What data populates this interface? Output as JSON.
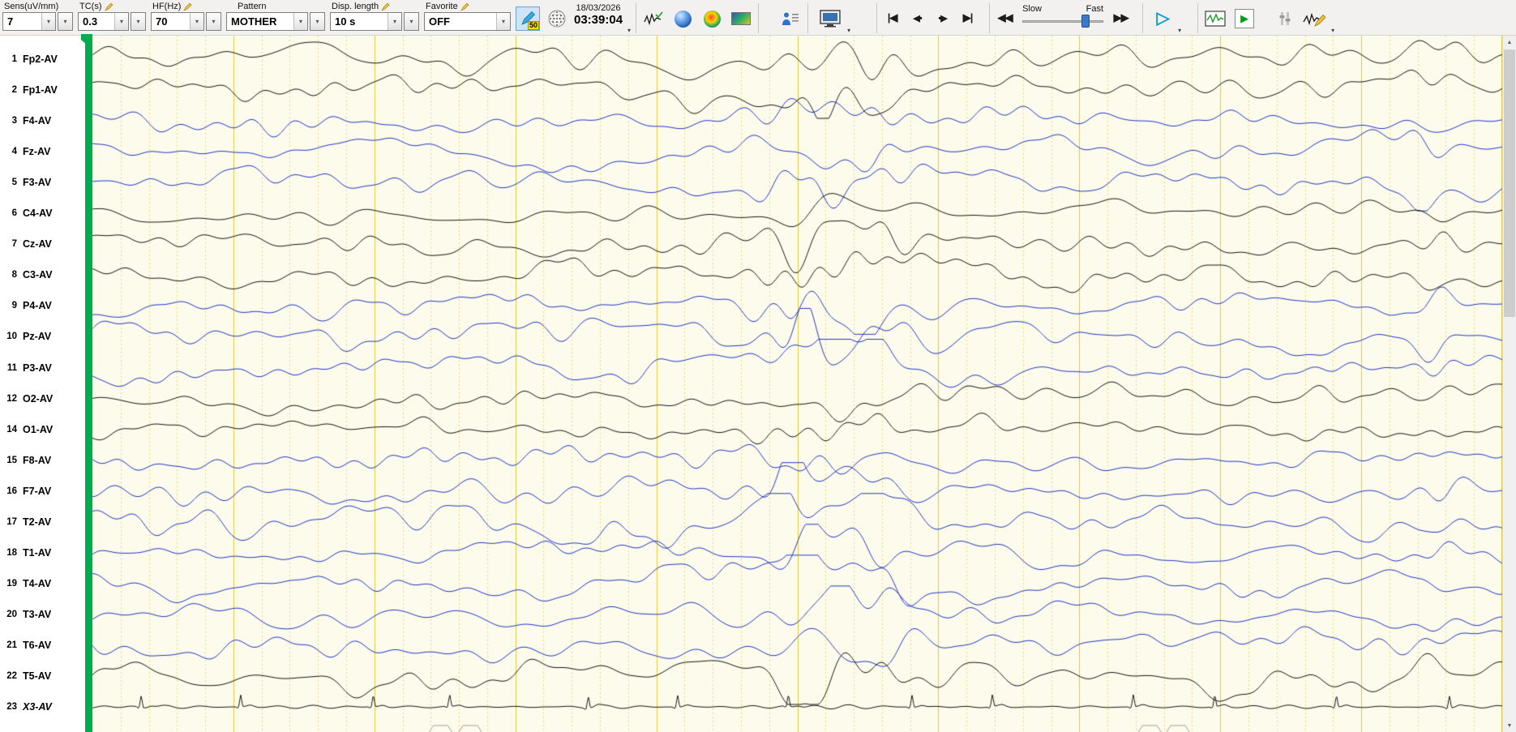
{
  "toolbar": {
    "sens": {
      "label": "Sens(uV/mm)",
      "value": "7"
    },
    "tc": {
      "label": "TC(s)",
      "value": "0.3"
    },
    "hf": {
      "label": "HF(Hz)",
      "value": "70"
    },
    "pattern": {
      "label": "Pattern",
      "value": "MOTHER"
    },
    "disp_length": {
      "label": "Disp. length",
      "value": "10 s"
    },
    "favorite": {
      "label": "Favorite",
      "value": "OFF"
    },
    "notch_badge": "50",
    "date": "18/03/2026",
    "time": "03:39:04",
    "speed": {
      "slow_label": "Slow",
      "fast_label": "Fast"
    }
  },
  "icons": {
    "combo_arrow": "▾",
    "dropdown_arrow": "▾",
    "skip_start": "|◀",
    "step_back": "◀•",
    "step_forward": "•▶",
    "skip_end": "▶|",
    "rewind": "◀◀",
    "forward": "▶▶",
    "play": "▷",
    "green_play": "▶",
    "scroll_up": "▲",
    "scroll_down": "▼"
  },
  "channels": [
    {
      "num": "1",
      "label": "Fp2-AV",
      "color": "black"
    },
    {
      "num": "2",
      "label": "Fp1-AV",
      "color": "black"
    },
    {
      "num": "3",
      "label": "F4-AV",
      "color": "blue"
    },
    {
      "num": "4",
      "label": "Fz-AV",
      "color": "blue"
    },
    {
      "num": "5",
      "label": "F3-AV",
      "color": "blue"
    },
    {
      "num": "6",
      "label": "C4-AV",
      "color": "black"
    },
    {
      "num": "7",
      "label": "Cz-AV",
      "color": "black"
    },
    {
      "num": "8",
      "label": "C3-AV",
      "color": "black"
    },
    {
      "num": "9",
      "label": "P4-AV",
      "color": "blue"
    },
    {
      "num": "10",
      "label": "Pz-AV",
      "color": "blue"
    },
    {
      "num": "11",
      "label": "P3-AV",
      "color": "blue"
    },
    {
      "num": "12",
      "label": "O2-AV",
      "color": "black"
    },
    {
      "num": "14",
      "label": "O1-AV",
      "color": "black"
    },
    {
      "num": "15",
      "label": "F8-AV",
      "color": "blue"
    },
    {
      "num": "16",
      "label": "F7-AV",
      "color": "blue"
    },
    {
      "num": "17",
      "label": "T2-AV",
      "color": "blue"
    },
    {
      "num": "18",
      "label": "T1-AV",
      "color": "blue"
    },
    {
      "num": "19",
      "label": "T4-AV",
      "color": "blue"
    },
    {
      "num": "20",
      "label": "T3-AV",
      "color": "blue"
    },
    {
      "num": "21",
      "label": "T6-AV",
      "color": "blue"
    },
    {
      "num": "22",
      "label": "T5-AV",
      "color": "black",
      "style": "ecg",
      "italic": false
    },
    {
      "num": "23",
      "label": "X3-AV",
      "color": "black",
      "style": "ecg2",
      "italic": true
    }
  ],
  "colors": {
    "trace_black": "#161616",
    "trace_blue": "#2238c4",
    "bg": "#fdfcec",
    "grid_major": "#e2c93a",
    "grid_minor": "#ecd878",
    "green_bar": "#00ad4e",
    "marker_gray": "#9f9f9f"
  },
  "display": {
    "seconds": 10,
    "minor_per_major": 5,
    "event_marker_positions": [
      0.247,
      0.268,
      0.75,
      0.77
    ]
  }
}
